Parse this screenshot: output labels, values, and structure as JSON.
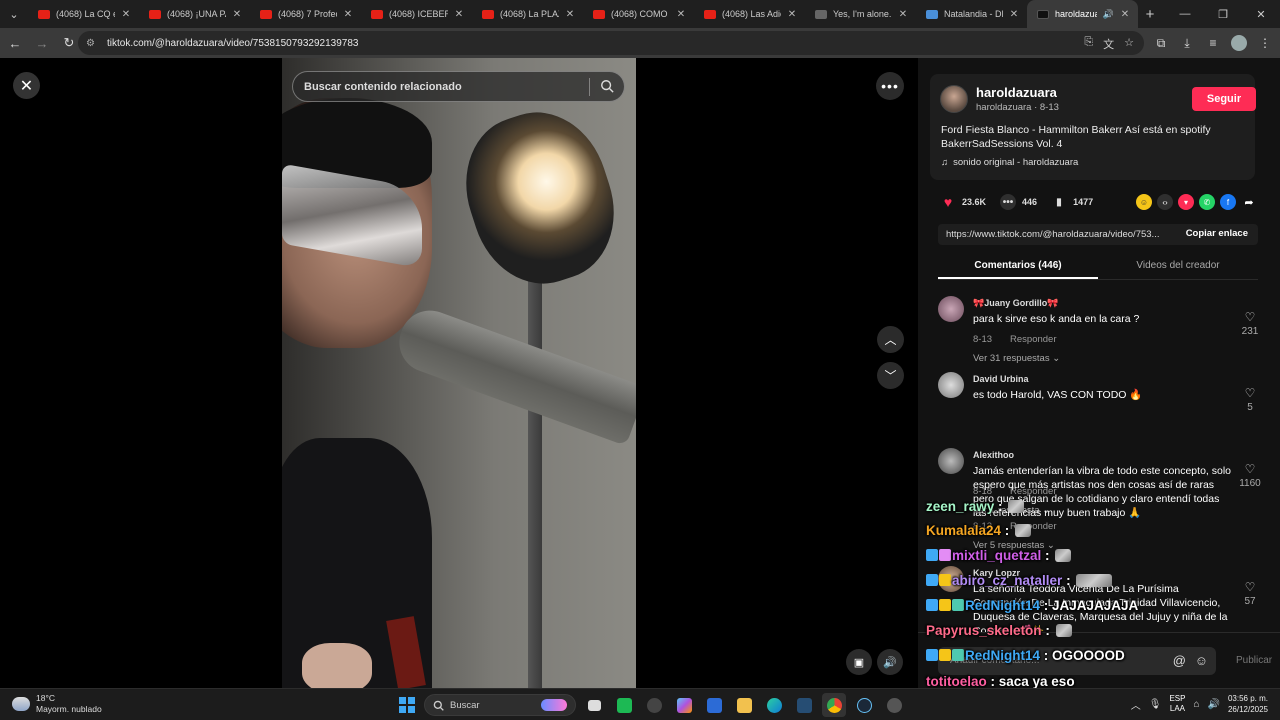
{
  "browser": {
    "tabs": [
      {
        "title": "(4068) La CQ era la",
        "favicon": "youtube",
        "active": false
      },
      {
        "title": "(4068) ¡UNA PAN",
        "favicon": "youtube",
        "active": false
      },
      {
        "title": "(4068) 7 Profecías",
        "favicon": "youtube",
        "active": false
      },
      {
        "title": "(4068) ICEBERG D",
        "favicon": "youtube",
        "active": false
      },
      {
        "title": "(4068) La PLAZA",
        "favicon": "youtube",
        "active": false
      },
      {
        "title": "(4068) COMO VE",
        "favicon": "youtube",
        "active": false
      },
      {
        "title": "(4068) Las Adiccio",
        "favicon": "youtube",
        "active": false
      },
      {
        "title": "Yes, I'm alone. by",
        "favicon": "generic",
        "active": false
      },
      {
        "title": "Natalandia - DEM",
        "favicon": "natalandia",
        "active": false
      },
      {
        "title": "haroldazuara",
        "favicon": "tiktok",
        "active": true
      }
    ],
    "url": "tiktok.com/@haroldazuara/video/7538150793292139783"
  },
  "video": {
    "search_placeholder": "Buscar contenido relacionado"
  },
  "post": {
    "username": "haroldazuara",
    "subline": "haroldazuara · 8-13",
    "follow_label": "Seguir",
    "description": "Ford Fiesta Blanco - Hammilton Bakerr Así está en spotify BakerrSadSessions Vol. 4",
    "sound": "sonido original - haroldazuara",
    "likes": "23.6K",
    "comments_count": "446",
    "saves": "1477",
    "share_link": "https://www.tiktok.com/@haroldazuara/video/753...",
    "copy_label": "Copiar enlace"
  },
  "panel_tabs": [
    {
      "label": "Comentarios (446)",
      "active": true
    },
    {
      "label": "Videos del creador",
      "active": false
    }
  ],
  "comments": [
    {
      "user": "🎀Juany Gordillo🎀",
      "text": "para k sirve eso k anda en la cara ?",
      "date": "8-13",
      "reply_label": "Responder",
      "replies": "Ver 31 respuestas ⌄",
      "likes": "231"
    },
    {
      "user": "David Urbina",
      "text": "es todo Harold, VAS CON TODO 🔥",
      "date": "8-18",
      "reply_label": "Responder",
      "replies": "Ver 1 respuesta ⌄",
      "likes": "5"
    },
    {
      "user": "Alexithoo",
      "text": "Jamás entenderían la vibra de todo este concepto, solo espero que más artistas nos den cosas así de raras pero que salgan de lo cotidiano y claro entendí todas las referencias muy buen trabajo 🙏",
      "date": "8-13",
      "reply_label": "Responder",
      "replies": "Ver 5 respuestas ⌄",
      "likes": "1160"
    },
    {
      "user": "Kary Lopzr",
      "text": "La señorita Teodora Vicenta De La Purísima Concepción De La Inmaculada Trinidad Villavicencio, Duquesa de Claveras, Marquesa del Jujuy y niña de la Condesa 💕✨",
      "date": "",
      "reply_label": "",
      "replies": "",
      "likes": "57"
    }
  ],
  "composer": {
    "placeholder": "Añadir comentario...",
    "publish_label": "Publicar"
  },
  "chat_overlay": [
    {
      "user": "zeen_rawy",
      "color": "#a6f5c8",
      "message": ""
    },
    {
      "user": "Kumalala24",
      "color": "#f5a623",
      "message": ""
    },
    {
      "user": "mixtli_quetzal",
      "color": "#d05fe8",
      "message": ""
    },
    {
      "user": "abiro_cz_nataller",
      "color": "#b28cf5",
      "message": ""
    },
    {
      "user": "RedNight14",
      "color": "#3fa9f5",
      "message": "JAJAJAJAJA"
    },
    {
      "user": "Papyrus_skeleton",
      "color": "#ff6b8a",
      "message": ""
    },
    {
      "user": "RedNight14",
      "color": "#3fa9f5",
      "message": "OGOOOOD"
    },
    {
      "user": "totitoelao",
      "color": "#ff5fa2",
      "message": "saca ya eso"
    },
    {
      "user": "Loveless156",
      "color": "#e38cf5",
      "message": ""
    }
  ],
  "taskbar": {
    "temp": "18°C",
    "weather": "Mayorm. nublado",
    "search_label": "Buscar",
    "lang_top": "ESP",
    "lang_bottom": "LAA",
    "time": "03:56 p. m.",
    "date": "26/12/2025"
  },
  "colors": {
    "accent": "#fe2c55",
    "panel_bg": "#121212",
    "browser_bg": "#3a3a3a"
  }
}
